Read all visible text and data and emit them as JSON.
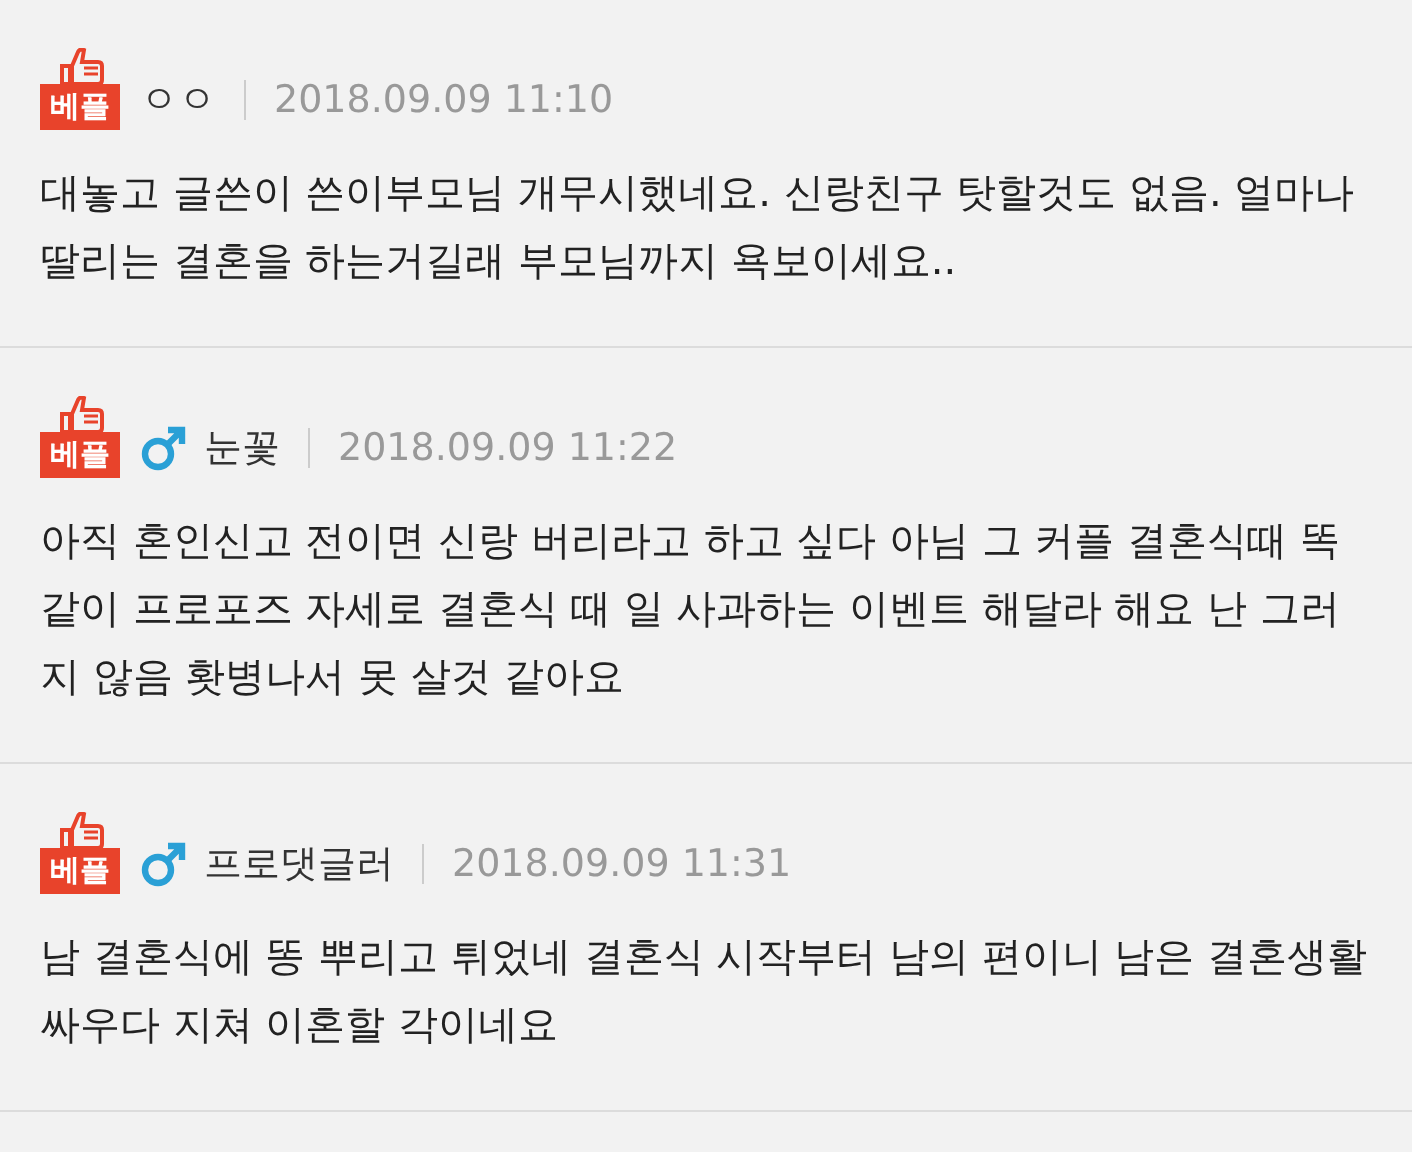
{
  "comments": [
    {
      "badge": "베플",
      "kind": "anonymous",
      "author": "ㅇㅇ",
      "date": "2018.09.09 11:10",
      "text": "대놓고 글쓴이 쓴이부모님 개무시했네요. 신랑친구 탓할것도 없음. 얼마나 딸리는 결혼을 하는거길래 부모님까지 욕보이세요.."
    },
    {
      "badge": "베플",
      "kind": "male",
      "author": "눈꽃",
      "date": "2018.09.09 11:22",
      "text": "아직 혼인신고 전이면 신랑 버리라고 하고 싶다 아님 그 커플 결혼식때 똑같이 프로포즈 자세로 결혼식 때 일 사과하는 이벤트 해달라 해요 난 그러지 않음 홧병나서 못 살것 같아요"
    },
    {
      "badge": "베플",
      "kind": "male",
      "author": "프로댓글러",
      "date": "2018.09.09 11:31",
      "text": "남 결혼식에 똥 뿌리고 튀었네 결혼식 시작부터 남의 편이니 남은 결혼생활 싸우다 지쳐 이혼할 각이네요"
    }
  ]
}
